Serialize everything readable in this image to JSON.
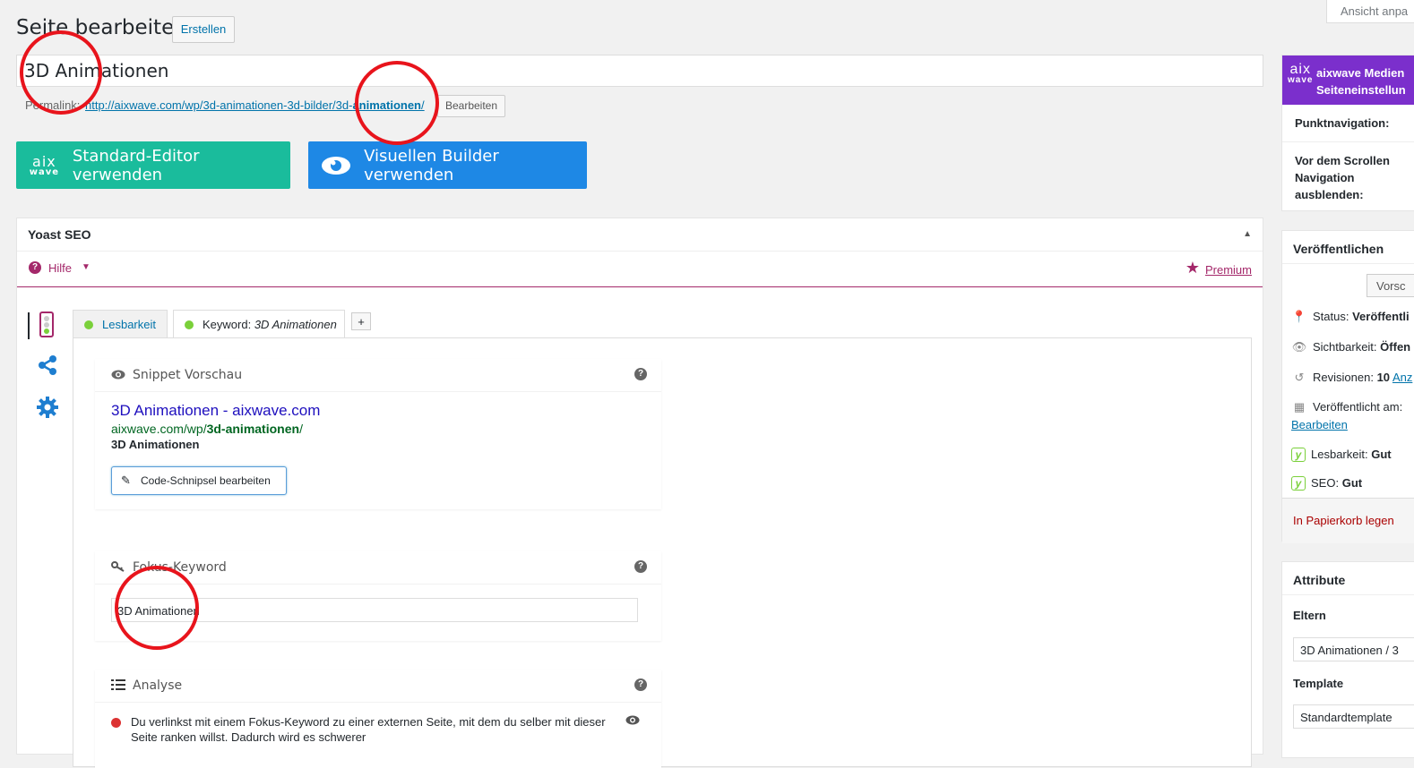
{
  "header": {
    "title": "Seite bearbeiten",
    "new_button": "Erstellen",
    "screen_options": "Ansicht anpa"
  },
  "post": {
    "title": "3D Animationen",
    "permalink_label": "Permalink:",
    "permalink_base": "http://aixwave.com/wp/3d-animationen-3d-bilder/3d-",
    "permalink_slug": "animationen",
    "permalink_end": "/",
    "permalink_edit": "Bearbeiten"
  },
  "builder": {
    "logo_top": "aix",
    "logo_bottom": "wave",
    "standard_label": "Standard-Editor verwenden",
    "visual_label": "Visuellen Builder verwenden"
  },
  "yoast": {
    "title": "Yoast SEO",
    "toggle": "▲",
    "help": "Hilfe",
    "help_caret": "▼",
    "premium": "Premium",
    "tabs": {
      "readability": "Lesbarkeit",
      "keyword_label": "Keyword:",
      "keyword_value": "3D Animationen",
      "add": "+"
    },
    "snippet": {
      "heading": "Snippet Vorschau",
      "help": "?",
      "title": "3D Animationen - aixwave.com",
      "url_base": "aixwave.com/wp/",
      "url_bold": "3d-animationen",
      "url_end": "/",
      "description": "3D Animationen",
      "edit_button": "Code-Schnipsel bearbeiten"
    },
    "focus": {
      "heading": "Fokus-Keyword",
      "help": "?",
      "value": "3D Animationen"
    },
    "analysis": {
      "heading": "Analyse",
      "help": "?",
      "item": "Du verlinkst mit einem Fokus-Keyword zu einer externen Seite, mit dem du selber mit dieser Seite ranken willst. Dadurch wird es schwerer"
    }
  },
  "sidebar": {
    "aixwave": {
      "logo_top": "aix",
      "logo_bottom": "wave",
      "title_line1": "aixwave Medien",
      "title_line2": "Seiteneinstellun",
      "nav_label": "Punktnavigation:",
      "scroll_label": "Vor dem Scrollen Navigation ausblenden:"
    },
    "publish": {
      "title": "Veröffentlichen",
      "preview": "Vorsc",
      "status_label": "Status:",
      "status_value": "Veröffentli",
      "visibility_label": "Sichtbarkeit:",
      "visibility_value": "Öffen",
      "revisions_label": "Revisionen:",
      "revisions_value": "10",
      "revisions_link": "Anz",
      "published_label": "Veröffentlicht am:",
      "edit_link": "Bearbeiten",
      "readability_label": "Lesbarkeit:",
      "readability_value": "Gut",
      "seo_label": "SEO:",
      "seo_value": "Gut",
      "trash": "In Papierkorb legen"
    },
    "attributes": {
      "title": "Attribute",
      "parent_label": "Eltern",
      "parent_value": "3D Animationen / 3",
      "template_label": "Template",
      "template_value": "Standardtemplate"
    }
  },
  "colors": {
    "standard_button": "#1abc9c",
    "visual_button": "#1e88e5",
    "yoast_accent": "#a4286a",
    "aixwave_purple": "#7b2fcc",
    "annotation_red": "#e8141c"
  }
}
